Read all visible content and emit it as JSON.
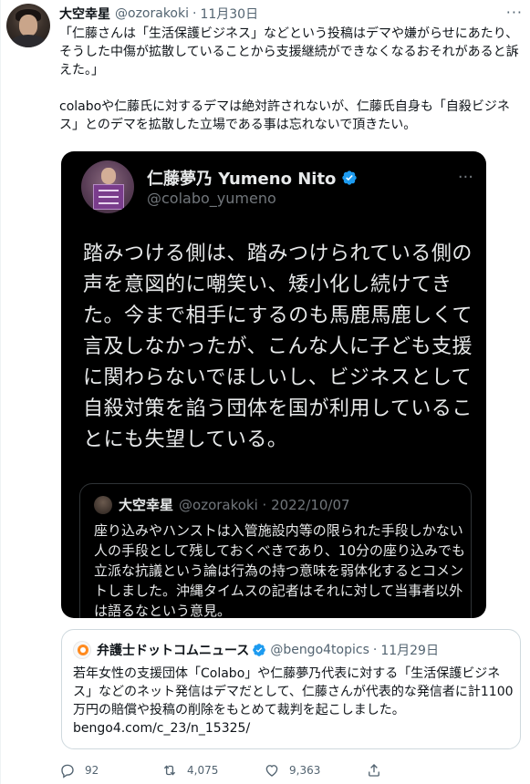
{
  "tweet": {
    "author_name": "大空幸星",
    "author_handle": "@ozorakoki",
    "separator": "·",
    "date": "11月30日",
    "more": "···",
    "text": "「仁藤さんは「生活保護ビジネス」などという投稿はデマや嫌がらせにあたり、そうした中傷が拡散していることから支援継続ができなくなるおそれがあると訴えた。」\n\ncolaboや仁藤氏に対するデマは絶対許されないが、仁藤氏自身も「自殺ビジネス」とのデマを拡散した立場である事は忘れないで頂きたい。"
  },
  "image_tweet": {
    "author_name": "仁藤夢乃  Yumeno Nito",
    "author_handle": "@colabo_yumeno",
    "more": "···",
    "text": "踏みつける側は、踏みつけられている側の声を意図的に嘲笑い、矮小化し続けてきた。今まで相手にするのも馬鹿馬鹿しくて言及しなかったが、こんな人に子ども支援に関わらないでほしいし、ビジネスとして自殺対策を諂う団体を国が利用していることにも失望している。",
    "quoted": {
      "author_name": "大空幸星",
      "author_handle": "@ozorakoki · 2022/10/07",
      "text": "座り込みやハンストは入管施設内等の限られた手段しかない人の手段として残しておくべきであり、10分の座り込みでも立派な抗議という論は行為の持つ意味を弱体化するとコメントしました。沖縄タイムスの記者はそれに対して当事者以外は語るなという意見。"
    }
  },
  "quote_tweet": {
    "author_name": "弁護士ドットコムニュース",
    "author_handle": "@bengo4topics",
    "separator": "·",
    "date": "11月29日",
    "text": "若年女性の支援団体「Colabo」や仁藤夢乃代表に対する「生活保護ビジネス」などのネット発信はデマだとして、仁藤さんが代表的な発信者に計1100万円の賠償や投稿の削除をもとめて裁判を起こしました。",
    "link": "bengo4.com/c_23/n_15325/"
  },
  "actions": {
    "reply_count": "92",
    "retweet_count": "4,075",
    "like_count": "9,363"
  },
  "colors": {
    "verified": "#1d9bf0",
    "muted": "#536471",
    "image_bg": "#000000"
  }
}
